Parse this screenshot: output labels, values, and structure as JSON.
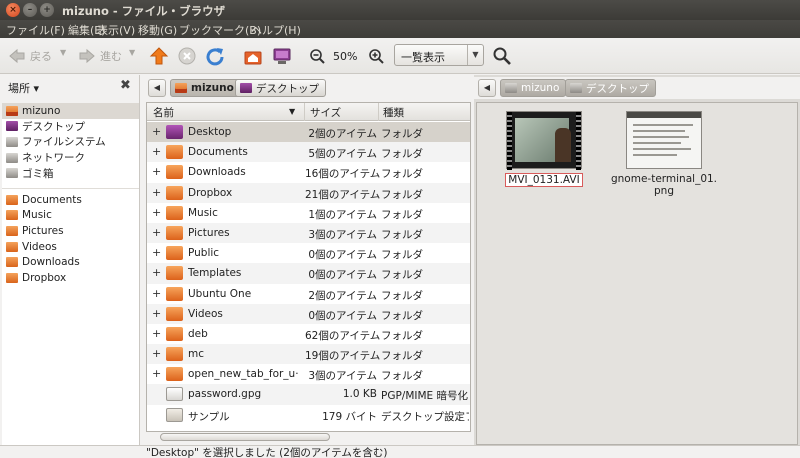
{
  "window": {
    "title": "mizuno - ファイル・ブラウザ",
    "close_glyph": "×",
    "min_glyph": "–",
    "max_glyph": "+"
  },
  "menu": [
    "ファイル(F)",
    "編集(E)",
    "表示(V)",
    "移動(G)",
    "ブックマーク(B)",
    "ヘルプ(H)"
  ],
  "toolbar": {
    "back_label": "戻る",
    "forward_label": "進む",
    "zoom_level": "50%",
    "view_mode": "一覧表示"
  },
  "sidebar": {
    "header": "場所 ▾",
    "places": [
      {
        "label": "mizuno",
        "icon": "home-folder-icon",
        "selected": true
      },
      {
        "label": "デスクトップ",
        "icon": "desktop-icon"
      },
      {
        "label": "ファイルシステム",
        "icon": "drive-icon"
      },
      {
        "label": "ネットワーク",
        "icon": "network-icon"
      },
      {
        "label": "ゴミ箱",
        "icon": "trash-icon"
      }
    ],
    "bookmarks": [
      {
        "label": "Documents",
        "icon": "folder-icon"
      },
      {
        "label": "Music",
        "icon": "folder-icon"
      },
      {
        "label": "Pictures",
        "icon": "folder-icon"
      },
      {
        "label": "Videos",
        "icon": "folder-icon"
      },
      {
        "label": "Downloads",
        "icon": "folder-icon"
      },
      {
        "label": "Dropbox",
        "icon": "folder-icon"
      }
    ]
  },
  "left_pane": {
    "breadcrumbs": [
      "mizuno",
      "デスクトップ"
    ],
    "columns": {
      "name": "名前",
      "size": "サイズ",
      "type": "種類"
    },
    "rows": [
      {
        "name": "Desktop",
        "size": "2個のアイテム",
        "type": "フォルダ",
        "icon": "desktop-folder-icon",
        "expandable": true,
        "selected": true
      },
      {
        "name": "Documents",
        "size": "5個のアイテム",
        "type": "フォルダ",
        "icon": "documents-folder-icon",
        "expandable": true
      },
      {
        "name": "Downloads",
        "size": "16個のアイテム",
        "type": "フォルダ",
        "icon": "downloads-folder-icon",
        "expandable": true
      },
      {
        "name": "Dropbox",
        "size": "21個のアイテム",
        "type": "フォルダ",
        "icon": "folder-icon",
        "expandable": true
      },
      {
        "name": "Music",
        "size": "1個のアイテム",
        "type": "フォルダ",
        "icon": "music-folder-icon",
        "expandable": true
      },
      {
        "name": "Pictures",
        "size": "3個のアイテム",
        "type": "フォルダ",
        "icon": "pictures-folder-icon",
        "expandable": true
      },
      {
        "name": "Public",
        "size": "0個のアイテム",
        "type": "フォルダ",
        "icon": "public-folder-icon",
        "expandable": true
      },
      {
        "name": "Templates",
        "size": "0個のアイテム",
        "type": "フォルダ",
        "icon": "templates-folder-icon",
        "expandable": true
      },
      {
        "name": "Ubuntu One",
        "size": "2個のアイテム",
        "type": "フォルダ",
        "icon": "ubuntu-one-folder-icon",
        "expandable": true
      },
      {
        "name": "Videos",
        "size": "0個のアイテム",
        "type": "フォルダ",
        "icon": "videos-folder-icon",
        "expandable": true
      },
      {
        "name": "deb",
        "size": "62個のアイテム",
        "type": "フォルダ",
        "icon": "folder-icon",
        "expandable": true
      },
      {
        "name": "mc",
        "size": "19個のアイテム",
        "type": "フォルダ",
        "icon": "folder-icon",
        "expandable": true
      },
      {
        "name": "open_new_tab_for_u···",
        "size": "3個のアイテム",
        "type": "フォルダ",
        "icon": "folder-icon",
        "expandable": true
      },
      {
        "name": "password.gpg",
        "size": "1.0 KB",
        "type": "PGP/MIME 暗号化",
        "icon": "document-icon",
        "expandable": false
      },
      {
        "name": "サンプル",
        "size": "179 バイト",
        "type": "デスクトップ設定ファ",
        "icon": "desktop-file-icon",
        "expandable": false
      }
    ]
  },
  "right_pane": {
    "breadcrumbs": [
      "mizuno",
      "デスクトップ"
    ],
    "items": [
      {
        "label": "MVI_0131.AVI",
        "selected": true
      },
      {
        "label": "gnome-terminal_01.\npng",
        "selected": false
      }
    ]
  },
  "status": "\"Desktop\" を選択しました (2個のアイテムを含む)"
}
